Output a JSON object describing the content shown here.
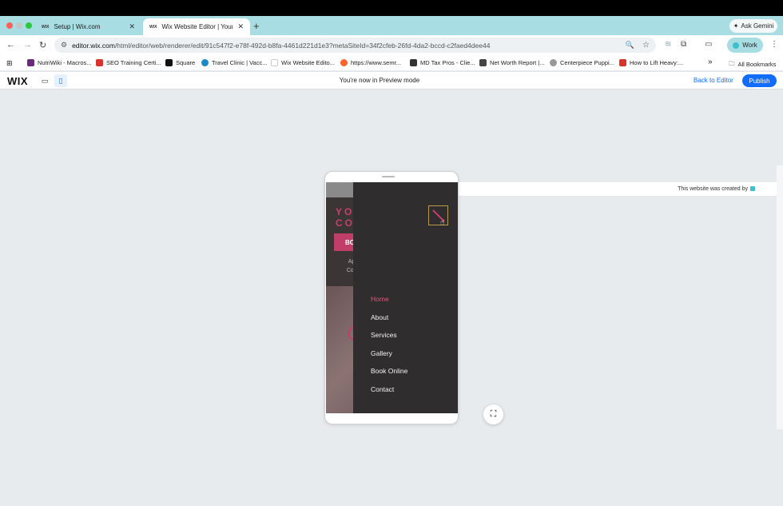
{
  "browser": {
    "tabs": [
      {
        "title": "Setup | Wix.com",
        "favicon": "WIX",
        "active": false
      },
      {
        "title": "Wix Website Editor | Your Nai",
        "favicon": "WIX",
        "active": true
      }
    ],
    "new_tab": "+",
    "gemini_label": "Ask Gemini",
    "url_host": "editor.wix.com",
    "url_path": "/html/editor/web/renderer/edit/91c547f2-e78f-492d-b8fa-4461d221d1e3?metaSiteId=34f2cfeb-26fd-4da2-bccd-c2faed4dee44",
    "profile_label": "Work",
    "bookmarks": [
      {
        "label": "NutriWiki - Macros...",
        "color": "#6a2a7a"
      },
      {
        "label": "SEO Training Certi...",
        "color": "#d9342b"
      },
      {
        "label": "Square",
        "color": "#111111"
      },
      {
        "label": "Travel Clinic | Vacc...",
        "color": "#1e88c9"
      },
      {
        "label": "Wix Website Edito...",
        "color": "#ffffff"
      },
      {
        "label": "https://www.semr...",
        "color": "#ff642d"
      },
      {
        "label": "MD Tax Pros - Clie...",
        "color": "#333333"
      },
      {
        "label": "Net Worth Report |...",
        "color": "#444444"
      },
      {
        "label": "Centerpiece Puppi...",
        "color": "#999999"
      },
      {
        "label": "How to Lift Heavy:...",
        "color": "#d9342b"
      }
    ],
    "more_bookmarks": "»",
    "all_bookmarks": "All Bookmarks"
  },
  "wix_bar": {
    "logo": "WIX",
    "preview_message": "You're now in Preview mode",
    "back_to_editor": "Back to Editor",
    "publish": "Publish"
  },
  "site": {
    "logo_line1": "YO",
    "logo_line2": "CO",
    "book_button": "BO",
    "sub_line1": "App",
    "sub_line2": "Conv",
    "menu_items": [
      "Home",
      "About",
      "Services",
      "Gallery",
      "Book Online",
      "Contact"
    ],
    "current_item": "Home"
  },
  "created_by_text": "This website was created by",
  "colors": {
    "accent_pink": "#c03e69",
    "wix_blue": "#116dff",
    "tab_strip": "#a7dde3"
  }
}
